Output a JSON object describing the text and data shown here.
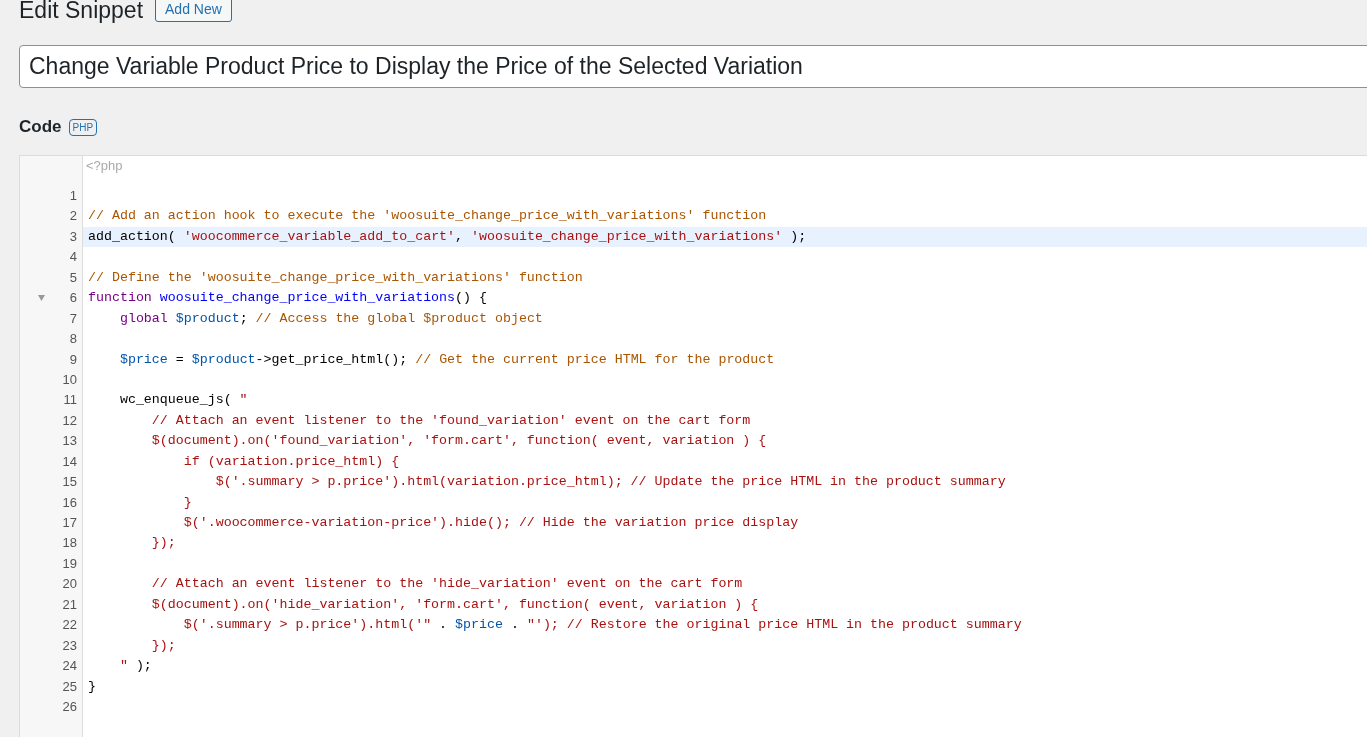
{
  "header": {
    "title": "Edit Snippet",
    "add_new_button": "Add New"
  },
  "snippet_title": {
    "value": "Change Variable Product Price to Display the Price of the Selected Variation"
  },
  "code_section": {
    "label": "Code",
    "language_badge": "PHP"
  },
  "editor": {
    "opening_tag": "<?php",
    "lines": [
      {
        "number": "1",
        "active": false,
        "foldable": false
      },
      {
        "number": "2",
        "active": false,
        "foldable": false,
        "tokens": [
          {
            "kind": "comment",
            "text": "// Add an action hook to execute the 'woosuite_change_price_with_variations' function"
          }
        ]
      },
      {
        "number": "3",
        "active": true,
        "foldable": false,
        "tokens": [
          {
            "kind": "plain",
            "text": "add_action( "
          },
          {
            "kind": "string",
            "text": "'woocommerce_variable_add_to_cart'"
          },
          {
            "kind": "plain",
            "text": ", "
          },
          {
            "kind": "string",
            "text": "'woosuite_change_price_with_variations'"
          },
          {
            "kind": "plain",
            "text": " );"
          }
        ]
      },
      {
        "number": "4",
        "active": false,
        "foldable": false
      },
      {
        "number": "5",
        "active": false,
        "foldable": false,
        "tokens": [
          {
            "kind": "comment",
            "text": "// Define the 'woosuite_change_price_with_variations' function"
          }
        ]
      },
      {
        "number": "6",
        "active": false,
        "foldable": true,
        "tokens": [
          {
            "kind": "keyword",
            "text": "function"
          },
          {
            "kind": "def",
            "text": " woosuite_change_price_with_variations"
          },
          {
            "kind": "plain",
            "text": "() {"
          }
        ]
      },
      {
        "number": "7",
        "active": false,
        "foldable": false,
        "tokens": [
          {
            "kind": "keyword",
            "text": "    global"
          },
          {
            "kind": "variable",
            "text": " $product"
          },
          {
            "kind": "plain",
            "text": "; "
          },
          {
            "kind": "comment",
            "text": "// Access the global $product object"
          }
        ]
      },
      {
        "number": "8",
        "active": false,
        "foldable": false
      },
      {
        "number": "9",
        "active": false,
        "foldable": false,
        "tokens": [
          {
            "kind": "variable",
            "text": "    $price"
          },
          {
            "kind": "plain",
            "text": " = "
          },
          {
            "kind": "variable",
            "text": "$product"
          },
          {
            "kind": "plain",
            "text": "->get_price_html(); "
          },
          {
            "kind": "comment",
            "text": "// Get the current price HTML for the product"
          }
        ]
      },
      {
        "number": "10",
        "active": false,
        "foldable": false
      },
      {
        "number": "11",
        "active": false,
        "foldable": false,
        "tokens": [
          {
            "kind": "plain",
            "text": "    wc_enqueue_js( "
          },
          {
            "kind": "string",
            "text": "\""
          }
        ]
      },
      {
        "number": "12",
        "active": false,
        "foldable": false,
        "tokens": [
          {
            "kind": "string",
            "text": "        // Attach an event listener to the 'found_variation' event on the cart form"
          }
        ]
      },
      {
        "number": "13",
        "active": false,
        "foldable": false,
        "tokens": [
          {
            "kind": "string",
            "text": "        $(document).on('found_variation', 'form.cart', function( event, variation ) {"
          }
        ]
      },
      {
        "number": "14",
        "active": false,
        "foldable": false,
        "tokens": [
          {
            "kind": "string",
            "text": "            if (variation.price_html) {"
          }
        ]
      },
      {
        "number": "15",
        "active": false,
        "foldable": false,
        "tokens": [
          {
            "kind": "string",
            "text": "                $('.summary > p.price').html(variation.price_html); // Update the price HTML in the product summary"
          }
        ]
      },
      {
        "number": "16",
        "active": false,
        "foldable": false,
        "tokens": [
          {
            "kind": "string",
            "text": "            }"
          }
        ]
      },
      {
        "number": "17",
        "active": false,
        "foldable": false,
        "tokens": [
          {
            "kind": "string",
            "text": "            $('.woocommerce-variation-price').hide(); // Hide the variation price display"
          }
        ]
      },
      {
        "number": "18",
        "active": false,
        "foldable": false,
        "tokens": [
          {
            "kind": "string",
            "text": "        });"
          }
        ]
      },
      {
        "number": "19",
        "active": false,
        "foldable": false
      },
      {
        "number": "20",
        "active": false,
        "foldable": false,
        "tokens": [
          {
            "kind": "string",
            "text": "        // Attach an event listener to the 'hide_variation' event on the cart form"
          }
        ]
      },
      {
        "number": "21",
        "active": false,
        "foldable": false,
        "tokens": [
          {
            "kind": "string",
            "text": "        $(document).on('hide_variation', 'form.cart', function( event, variation ) {"
          }
        ]
      },
      {
        "number": "22",
        "active": false,
        "foldable": false,
        "tokens": [
          {
            "kind": "string",
            "text": "            $('.summary > p.price').html('\""
          },
          {
            "kind": "plain",
            "text": " . "
          },
          {
            "kind": "variable",
            "text": "$price"
          },
          {
            "kind": "plain",
            "text": " . "
          },
          {
            "kind": "string",
            "text": "\"'); // Restore the original price HTML in the product summary"
          }
        ]
      },
      {
        "number": "23",
        "active": false,
        "foldable": false,
        "tokens": [
          {
            "kind": "string",
            "text": "        });"
          }
        ]
      },
      {
        "number": "24",
        "active": false,
        "foldable": false,
        "tokens": [
          {
            "kind": "string",
            "text": "    \""
          },
          {
            "kind": "plain",
            "text": " );"
          }
        ]
      },
      {
        "number": "25",
        "active": false,
        "foldable": false,
        "tokens": [
          {
            "kind": "plain",
            "text": "}"
          }
        ]
      },
      {
        "number": "26",
        "active": false,
        "foldable": false
      }
    ]
  }
}
